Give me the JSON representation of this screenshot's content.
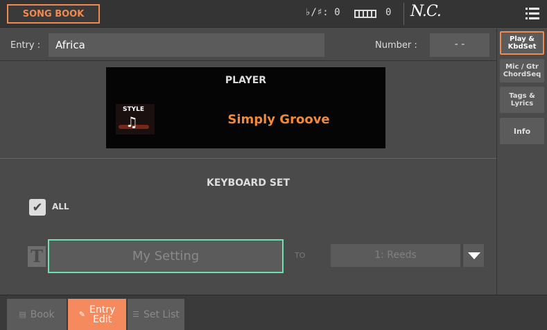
{
  "topbar": {
    "mode": "SONG BOOK",
    "transpose": "♭/♯: 0",
    "octave": "0",
    "chord": "N.C."
  },
  "entry": {
    "label": "Entry :",
    "value": "Africa",
    "number_label": "Number :",
    "number_value": "- -"
  },
  "tabs": [
    {
      "label": "Play & KbdSet",
      "active": true
    },
    {
      "label": "Mic / Gtr ChordSeq",
      "active": false
    },
    {
      "label": "Tags & Lyrics",
      "active": false
    },
    {
      "label": "Info",
      "active": false
    }
  ],
  "player": {
    "title": "PLAYER",
    "thumb_label": "STYLE",
    "style_name": "Simply Groove"
  },
  "keyboard_set": {
    "title": "KEYBOARD SET",
    "all_label": "ALL",
    "all_checked": true,
    "setting_name": "My Setting",
    "to_label": "TO",
    "destination": "1: Reeds"
  },
  "bottom_tabs": [
    {
      "label": "Book",
      "active": false
    },
    {
      "label_line1": "Entry",
      "label_line2": "Edit",
      "active": true
    },
    {
      "label": "Set List",
      "active": false
    }
  ],
  "colors": {
    "accent": "#f08a50",
    "style_name": "#f08a3a",
    "focus": "#6fe0b0"
  }
}
